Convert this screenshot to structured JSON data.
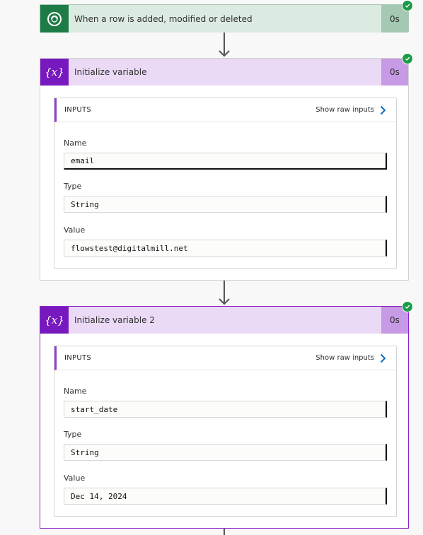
{
  "trigger": {
    "title": "When a row is added, modified or deleted",
    "duration": "0s",
    "icon": "dataverse-icon"
  },
  "actions": [
    {
      "title": "Initialize variable",
      "duration": "0s",
      "icon": "variable-icon",
      "inputs_label": "INPUTS",
      "raw_label": "Show raw inputs",
      "fields": [
        {
          "label": "Name",
          "value": "email"
        },
        {
          "label": "Type",
          "value": "String"
        },
        {
          "label": "Value",
          "value": "flowstest@digitalmill.net"
        }
      ]
    },
    {
      "title": "Initialize variable 2",
      "duration": "0s",
      "icon": "variable-icon",
      "inputs_label": "INPUTS",
      "raw_label": "Show raw inputs",
      "fields": [
        {
          "label": "Name",
          "value": "start_date"
        },
        {
          "label": "Type",
          "value": "String"
        },
        {
          "label": "Value",
          "value": "Dec 14, 2024"
        }
      ]
    }
  ],
  "colors": {
    "trigger_accent": "#1e7b45",
    "variable_accent": "#7719bf",
    "success": "#1a9c47",
    "link_chevron": "#0f6cbd"
  }
}
